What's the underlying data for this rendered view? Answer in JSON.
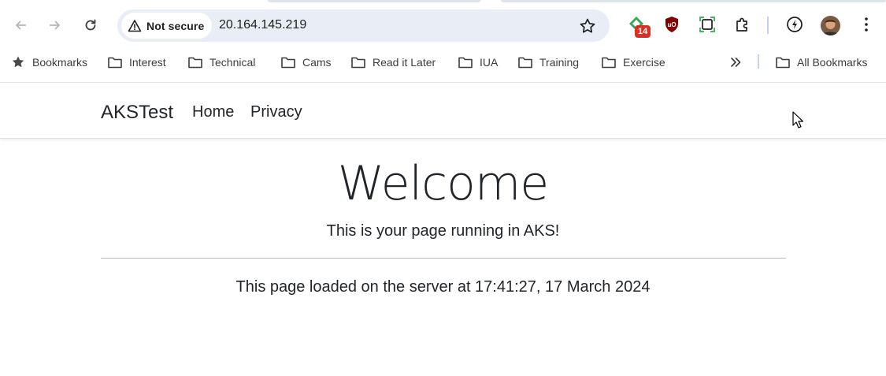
{
  "browser": {
    "security_label": "Not secure",
    "url": "20.164.145.219",
    "extension_badge": "14"
  },
  "bookmarks": {
    "items": [
      {
        "label": "Bookmarks",
        "icon": "star-icon"
      },
      {
        "label": "Interest",
        "icon": "folder-icon"
      },
      {
        "label": "Technical",
        "icon": "folder-icon"
      },
      {
        "label": "Cams",
        "icon": "folder-icon"
      },
      {
        "label": "Read it Later",
        "icon": "folder-icon"
      },
      {
        "label": "IUA",
        "icon": "folder-icon"
      },
      {
        "label": "Training",
        "icon": "folder-icon"
      },
      {
        "label": "Exercise",
        "icon": "folder-icon"
      }
    ],
    "all_label": "All Bookmarks"
  },
  "navbar": {
    "brand": "AKSTest",
    "links": [
      "Home",
      "Privacy"
    ]
  },
  "main": {
    "heading": "Welcome",
    "subtitle": "This is your page running in AKS!",
    "loaded_text": "This page loaded on the server at 17:41:27, 17 March 2024"
  },
  "colors": {
    "badge": "#d93025",
    "omnibox": "#e9eef6",
    "text": "#212529"
  }
}
